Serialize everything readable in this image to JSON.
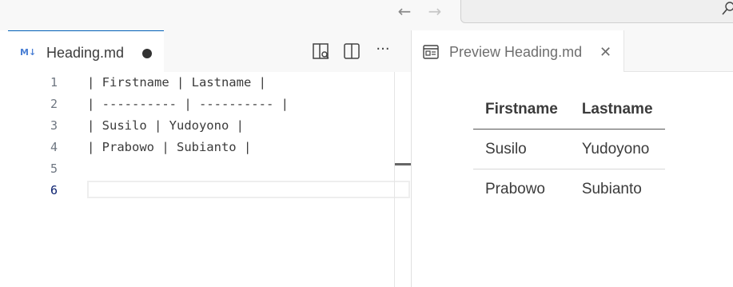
{
  "titlebar": {
    "back_icon": "arrow-left-icon",
    "forward_icon": "arrow-right-icon",
    "search_icon": "search-icon"
  },
  "editor": {
    "tab": {
      "label": "Heading.md",
      "file_icon": "markdown-icon",
      "icon_text": "M↓",
      "dirty": true
    },
    "actions": [
      {
        "name": "open-preview-to-side-icon"
      },
      {
        "name": "split-editor-icon"
      },
      {
        "name": "more-actions-icon",
        "glyph": "···"
      }
    ],
    "lines": [
      {
        "number": "1",
        "text": "| Firstname | Lastname |"
      },
      {
        "number": "2",
        "text": "| ---------- | ---------- |"
      },
      {
        "number": "3",
        "text": "| Susilo | Yudoyono |"
      },
      {
        "number": "4",
        "text": "| Prabowo | Subianto |"
      },
      {
        "number": "5",
        "text": ""
      },
      {
        "number": "6",
        "text": ""
      }
    ],
    "active_line": "6"
  },
  "preview": {
    "tab": {
      "label": "Preview Heading.md",
      "close_glyph": "✕"
    },
    "table": {
      "headers": [
        "Firstname",
        "Lastname"
      ],
      "rows": [
        [
          "Susilo",
          "Yudoyono"
        ],
        [
          "Prabowo",
          "Subianto"
        ]
      ]
    }
  },
  "colors": {
    "accent": "#005fb8",
    "markdown_icon": "#4a7fd4",
    "active_line_number": "#0b216f"
  }
}
